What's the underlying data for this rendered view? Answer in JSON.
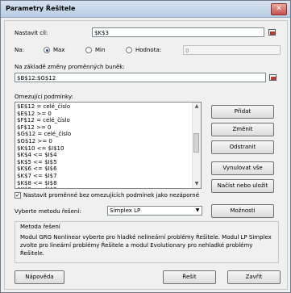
{
  "window": {
    "title": "Parametry Řešitele",
    "close": "✕"
  },
  "objective": {
    "label": "Nastavit cíl:",
    "value": "$K$3"
  },
  "target": {
    "label": "Na:",
    "options": [
      {
        "label": "Max",
        "selected": true
      },
      {
        "label": "Min",
        "selected": false
      },
      {
        "label": "Hodnota:",
        "selected": false
      }
    ],
    "value": "0"
  },
  "changing": {
    "label": "Na základě změny proměnných buněk:",
    "value": "$B$12:$G$12"
  },
  "constraints": {
    "label": "Omezující podmínky:",
    "items": [
      "$E$12 = celé_číslo",
      "$E$12 >= 0",
      "$F$12 = celé_číslo",
      "$F$12 >= 0",
      "$G$12 = celé_číslo",
      "$G$12 >= 0",
      "$K$10 <= $I$10",
      "$K$4 <= $I$4",
      "$K$5 <= $I$5",
      "$K$6 <= $I$6",
      "$K$7 <= $I$7",
      "$K$8 <= $I$8",
      "$K$9 <= $I$9"
    ]
  },
  "side_buttons": {
    "add": "Přidat",
    "change": "Změnit",
    "delete": "Odstranit",
    "reset": "Vynulovat vše",
    "load_save": "Načíst nebo uložit"
  },
  "nonneg": {
    "label": "Nastavit proměnné bez omezujících podmínek jako nezáporné",
    "checked": true,
    "mark": "✓"
  },
  "method": {
    "label": "Vyberte metodu řešení:",
    "value": "Simplex LP",
    "options_button": "Možnosti"
  },
  "method_info": {
    "title": "Metoda řešení",
    "text": "Modul GRG Nonlinear vyberte pro hladké nelineární problémy Řešitele. Modul LP Simplex zvolte pro lineární problémy Řešitele a modul Evolutionary pro nehladké problémy Řešitele."
  },
  "footer": {
    "help": "Nápověda",
    "solve": "Řešit",
    "close": "Zavřít"
  }
}
